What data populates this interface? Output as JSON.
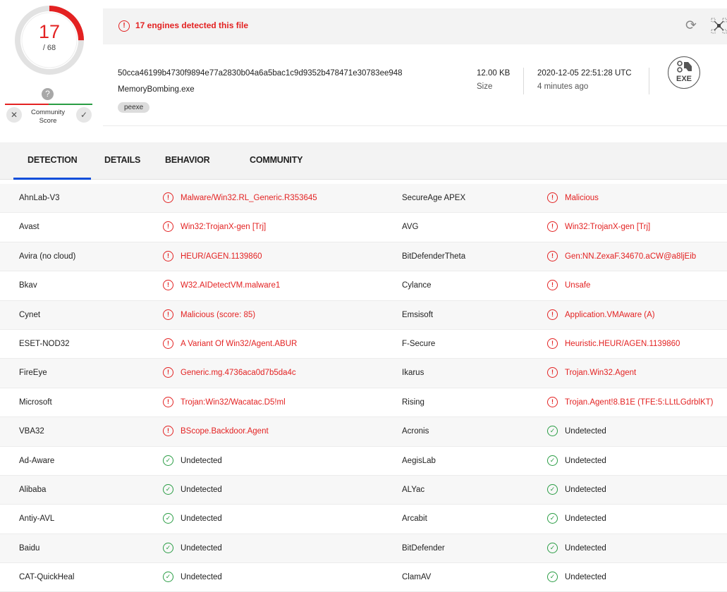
{
  "score": {
    "detected": "17",
    "total": "/ 68",
    "help_glyph": "?",
    "community_label": "Community Score",
    "community_label_line1": "Community",
    "community_label_line2": "Score",
    "accent_color": "#e32222",
    "ok_color": "#2a9d44"
  },
  "summary": {
    "alert_text": "17 engines detected this file",
    "hash": "50cca46199b4730f9894e77a2830b04a6a5bac1c9d9352b478471e30783ee948",
    "file_name": "MemoryBombing.exe",
    "tag": "peexe",
    "size_value": "12.00 KB",
    "size_label": "Size",
    "date": "2020-12-05 22:51:28 UTC",
    "date_ago": "4 minutes ago",
    "file_type": "EXE",
    "icons": [
      "alert-icon",
      "reload-icon",
      "graph-icon",
      "exe-file-icon"
    ]
  },
  "tabs": [
    {
      "label": "DETECTION",
      "active": true
    },
    {
      "label": "DETAILS",
      "active": false
    },
    {
      "label": "BEHAVIOR",
      "active": false
    },
    {
      "label": "COMMUNITY",
      "active": false
    }
  ],
  "detections": [
    [
      {
        "engine": "AhnLab-V3",
        "result": "Malware/Win32.RL_Generic.R353645",
        "malicious": true
      },
      {
        "engine": "SecureAge APEX",
        "result": "Malicious",
        "malicious": true
      }
    ],
    [
      {
        "engine": "Avast",
        "result": "Win32:TrojanX-gen [Trj]",
        "malicious": true
      },
      {
        "engine": "AVG",
        "result": "Win32:TrojanX-gen [Trj]",
        "malicious": true
      }
    ],
    [
      {
        "engine": "Avira (no cloud)",
        "result": "HEUR/AGEN.1139860",
        "malicious": true
      },
      {
        "engine": "BitDefenderTheta",
        "result": "Gen:NN.ZexaF.34670.aCW@a8ljEib",
        "malicious": true
      }
    ],
    [
      {
        "engine": "Bkav",
        "result": "W32.AIDetectVM.malware1",
        "malicious": true
      },
      {
        "engine": "Cylance",
        "result": "Unsafe",
        "malicious": true
      }
    ],
    [
      {
        "engine": "Cynet",
        "result": "Malicious (score: 85)",
        "malicious": true
      },
      {
        "engine": "Emsisoft",
        "result": "Application.VMAware (A)",
        "malicious": true
      }
    ],
    [
      {
        "engine": "ESET-NOD32",
        "result": "A Variant Of Win32/Agent.ABUR",
        "malicious": true
      },
      {
        "engine": "F-Secure",
        "result": "Heuristic.HEUR/AGEN.1139860",
        "malicious": true
      }
    ],
    [
      {
        "engine": "FireEye",
        "result": "Generic.mg.4736aca0d7b5da4c",
        "malicious": true
      },
      {
        "engine": "Ikarus",
        "result": "Trojan.Win32.Agent",
        "malicious": true
      }
    ],
    [
      {
        "engine": "Microsoft",
        "result": "Trojan:Win32/Wacatac.D5!ml",
        "malicious": true
      },
      {
        "engine": "Rising",
        "result": "Trojan.Agent!8.B1E (TFE:5:LLtLGdrblKT)",
        "malicious": true
      }
    ],
    [
      {
        "engine": "VBA32",
        "result": "BScope.Backdoor.Agent",
        "malicious": true
      },
      {
        "engine": "Acronis",
        "result": "Undetected",
        "malicious": false
      }
    ],
    [
      {
        "engine": "Ad-Aware",
        "result": "Undetected",
        "malicious": false
      },
      {
        "engine": "AegisLab",
        "result": "Undetected",
        "malicious": false
      }
    ],
    [
      {
        "engine": "Alibaba",
        "result": "Undetected",
        "malicious": false
      },
      {
        "engine": "ALYac",
        "result": "Undetected",
        "malicious": false
      }
    ],
    [
      {
        "engine": "Antiy-AVL",
        "result": "Undetected",
        "malicious": false
      },
      {
        "engine": "Arcabit",
        "result": "Undetected",
        "malicious": false
      }
    ],
    [
      {
        "engine": "Baidu",
        "result": "Undetected",
        "malicious": false
      },
      {
        "engine": "BitDefender",
        "result": "Undetected",
        "malicious": false
      }
    ],
    [
      {
        "engine": "CAT-QuickHeal",
        "result": "Undetected",
        "malicious": false
      },
      {
        "engine": "ClamAV",
        "result": "Undetected",
        "malicious": false
      }
    ]
  ]
}
